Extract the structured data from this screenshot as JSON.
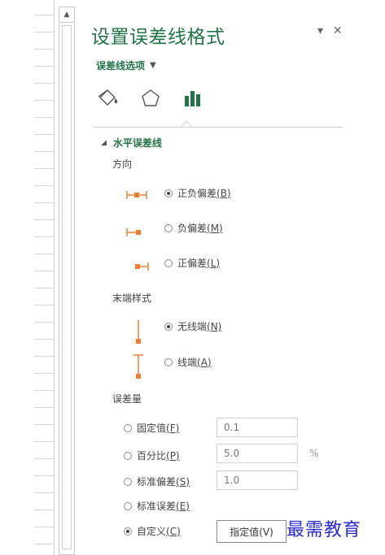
{
  "pane": {
    "title": "设置误差线格式",
    "options_dropdown": "误差线选项",
    "caret": "▼",
    "close": "✕",
    "menu_caret": "▾"
  },
  "tabs": [
    {
      "name": "fill-line",
      "icon": "paint-bucket-icon"
    },
    {
      "name": "effects",
      "icon": "pentagon-icon"
    },
    {
      "name": "error-bar-options",
      "icon": "bar-chart-icon",
      "active": true
    }
  ],
  "section": {
    "toggle": "◢",
    "title": "水平误差线"
  },
  "direction": {
    "label": "方向",
    "options": [
      {
        "label": "正负偏差",
        "key": "(B)",
        "selected": true,
        "icon": "both-error-bar-icon"
      },
      {
        "label": "负偏差",
        "key": "(M)",
        "selected": false,
        "icon": "minus-error-bar-icon"
      },
      {
        "label": "正偏差",
        "key": "(L)",
        "selected": false,
        "icon": "plus-error-bar-icon"
      }
    ]
  },
  "end_style": {
    "label": "末端样式",
    "options": [
      {
        "label": "无线端",
        "key": "(N)",
        "selected": true,
        "icon": "no-cap-icon"
      },
      {
        "label": "线端",
        "key": "(A)",
        "selected": false,
        "icon": "cap-icon"
      }
    ]
  },
  "error_amount": {
    "label": "误差量",
    "options": [
      {
        "label": "固定值",
        "key": "(F)",
        "selected": false,
        "value": "0.1"
      },
      {
        "label": "百分比",
        "key": "(P)",
        "selected": false,
        "value": "5.0",
        "unit": "%"
      },
      {
        "label": "标准偏差",
        "key": "(S)",
        "selected": false,
        "value": "1.0"
      },
      {
        "label": "标准误差",
        "key": "(E)",
        "selected": false
      },
      {
        "label": "自定义",
        "key": "(C)",
        "selected": true
      }
    ],
    "specify_button": "指定值(V)"
  },
  "watermark": "最需教育",
  "colors": {
    "accent": "#217346",
    "marker": "#ed7d31"
  }
}
